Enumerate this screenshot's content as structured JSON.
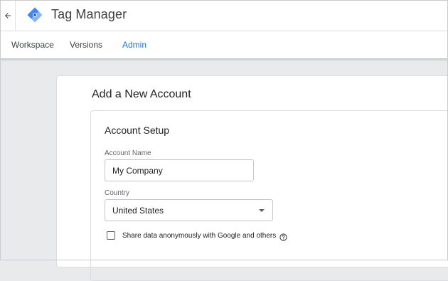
{
  "header": {
    "app_title": "Tag Manager",
    "back_icon": "arrow-left-icon",
    "logo_icon": "tag-manager-logo",
    "brand_colors": {
      "blue_light": "#8AB4F8",
      "blue_dark": "#4285F4"
    }
  },
  "nav": {
    "tabs": [
      {
        "label": "Workspace",
        "active": false
      },
      {
        "label": "Versions",
        "active": false
      },
      {
        "label": "Admin",
        "active": true
      }
    ],
    "active_color": "#1a73e8"
  },
  "page": {
    "title": "Add a New Account"
  },
  "account_setup": {
    "section_title": "Account Setup",
    "account_name": {
      "label": "Account Name",
      "value": "My Company"
    },
    "country": {
      "label": "Country",
      "value": "United States"
    },
    "share_data": {
      "label": "Share data anonymously with Google and others",
      "checked": false,
      "help_icon": "help-circle-icon"
    }
  }
}
